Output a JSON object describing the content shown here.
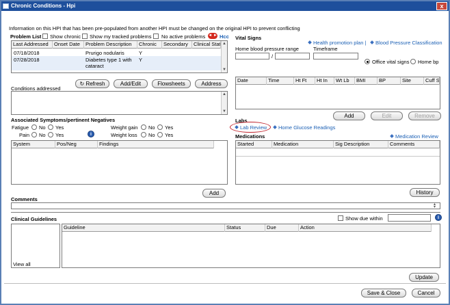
{
  "window": {
    "title": "Chronic Conditions - Hpi",
    "close": "x"
  },
  "info_text": "Information on this HPI that has been pre-populated from another HPI must be changed on the original HPI to prevent conflicting",
  "problem_list": {
    "title": "Problem List",
    "show_chronic": "Show chronic",
    "show_tracked": "Show my tracked problems",
    "no_active": "No active problems",
    "badge": "◄ ►",
    "hcc": "Hcc",
    "columns": [
      "Last Addressed",
      "Onset Date",
      "Problem Description",
      "Chronic",
      "Secondary",
      "Clinical Stat"
    ],
    "rows": [
      {
        "last_addressed": "07/18/2018",
        "onset": "",
        "description": "Prurigo nodularis",
        "chronic": "Y",
        "secondary": "",
        "status": ""
      },
      {
        "last_addressed": "07/28/2018",
        "onset": "",
        "description": "Diabetes type 1 with",
        "description2": "cataract",
        "chronic": "Y",
        "secondary": "",
        "status": ""
      }
    ]
  },
  "buttons": {
    "refresh": "Refresh",
    "add_edit": "Add/Edit",
    "flowsheets": "Flowsheets",
    "address": "Address",
    "add_symptoms": "Add",
    "vitals_add": "Add",
    "vitals_edit": "Edit",
    "vitals_remove": "Remove",
    "history": "History",
    "update": "Update",
    "save_close": "Save & Close",
    "cancel": "Cancel"
  },
  "conditions_addressed": {
    "label": "Conditions addressed"
  },
  "symptoms": {
    "title": "Associated Symptoms/pertinent Negatives",
    "items": [
      {
        "label": "Fatigue",
        "no": "No",
        "yes": "Yes"
      },
      {
        "label": "Pain",
        "no": "No",
        "yes": "Yes"
      },
      {
        "label": "Weight gain",
        "no": "No",
        "yes": "Yes"
      },
      {
        "label": "Weight loss",
        "no": "No",
        "yes": "Yes"
      }
    ],
    "info": "i",
    "columns": [
      "System",
      "Pos/Neg",
      "Findings"
    ]
  },
  "vital_signs": {
    "title": "Vital Signs",
    "health_link": "Health promotion plan |",
    "bp_link": "Blood Pressure Classification",
    "home_bp_label": "Home blood pressure range",
    "slash": "/",
    "timeframe_label": "Timeframe",
    "office_vitals": "Office vital signs",
    "home_bp": "Home bp",
    "columns": [
      "Date",
      "Time",
      "Ht Ft",
      "Ht In",
      "Wt Lb",
      "BMI",
      "BP",
      "Site",
      "Cuff Si"
    ]
  },
  "labs": {
    "title": "Labs",
    "lab_review": "Lab Review",
    "home_glucose": "Home Glucose Readings"
  },
  "medications": {
    "title": "Medications",
    "review_link": "Medication Review",
    "columns": [
      "Started",
      "Medication",
      "Sig Description",
      "Comments"
    ]
  },
  "comments": {
    "label": "Comments"
  },
  "guidelines": {
    "title": "Clinical Guidelines",
    "show_due": "Show due within",
    "view_all": "View all",
    "columns": [
      "Guideline",
      "Status",
      "Due",
      "Action"
    ],
    "info": "i"
  },
  "colors": {
    "titlebar": "#1e4f9c",
    "link": "#1a5fb4",
    "highlight_circle": "#c0202a"
  }
}
